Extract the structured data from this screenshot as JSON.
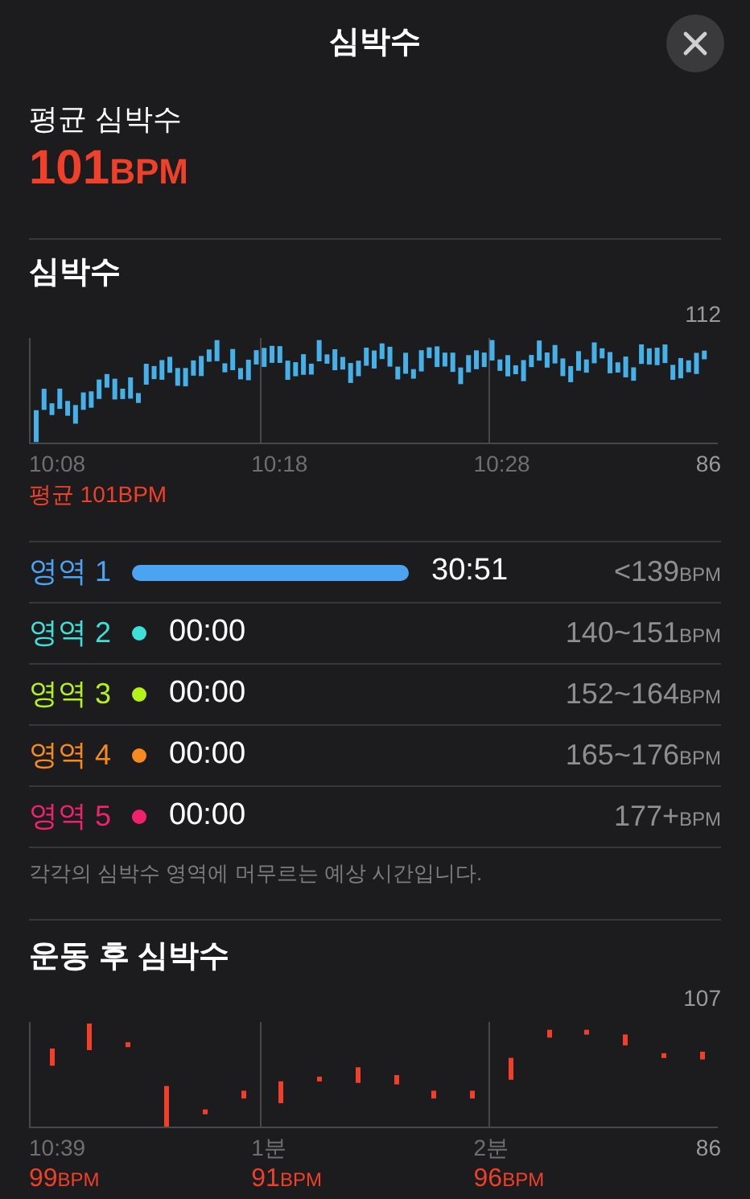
{
  "header": {
    "title": "심박수"
  },
  "average": {
    "label": "평균 심박수",
    "value": "101",
    "unit": "BPM"
  },
  "heart_rate": {
    "title": "심박수",
    "y_max": "112",
    "y_min": "86",
    "x_labels": [
      "10:08",
      "10:18",
      "10:28"
    ],
    "average": "평균 101BPM"
  },
  "zones": [
    {
      "kind": "bar",
      "label": "영역 1",
      "color": "#4ba3f2",
      "time": "30:51",
      "range": "<139",
      "unit": "BPM"
    },
    {
      "kind": "dot",
      "label": "영역 2",
      "color": "#3fe0da",
      "time": "00:00",
      "range": "140~151",
      "unit": "BPM"
    },
    {
      "kind": "dot",
      "label": "영역 3",
      "color": "#b5f21c",
      "time": "00:00",
      "range": "152~164",
      "unit": "BPM"
    },
    {
      "kind": "dot",
      "label": "영역 4",
      "color": "#f68a1e",
      "time": "00:00",
      "range": "165~176",
      "unit": "BPM"
    },
    {
      "kind": "dot",
      "label": "영역 5",
      "color": "#f0226e",
      "time": "00:00",
      "range": "177+",
      "unit": "BPM"
    }
  ],
  "zones_note": "각각의 심박수 영역에 머무르는 예상 시간입니다.",
  "recovery": {
    "title": "운동 후 심박수",
    "y_max": "107",
    "y_min": "86",
    "points": [
      {
        "time": "10:39",
        "value": "99",
        "unit": "BPM"
      },
      {
        "time": "1분",
        "value": "91",
        "unit": "BPM"
      },
      {
        "time": "2분",
        "value": "96",
        "unit": "BPM"
      }
    ]
  }
}
